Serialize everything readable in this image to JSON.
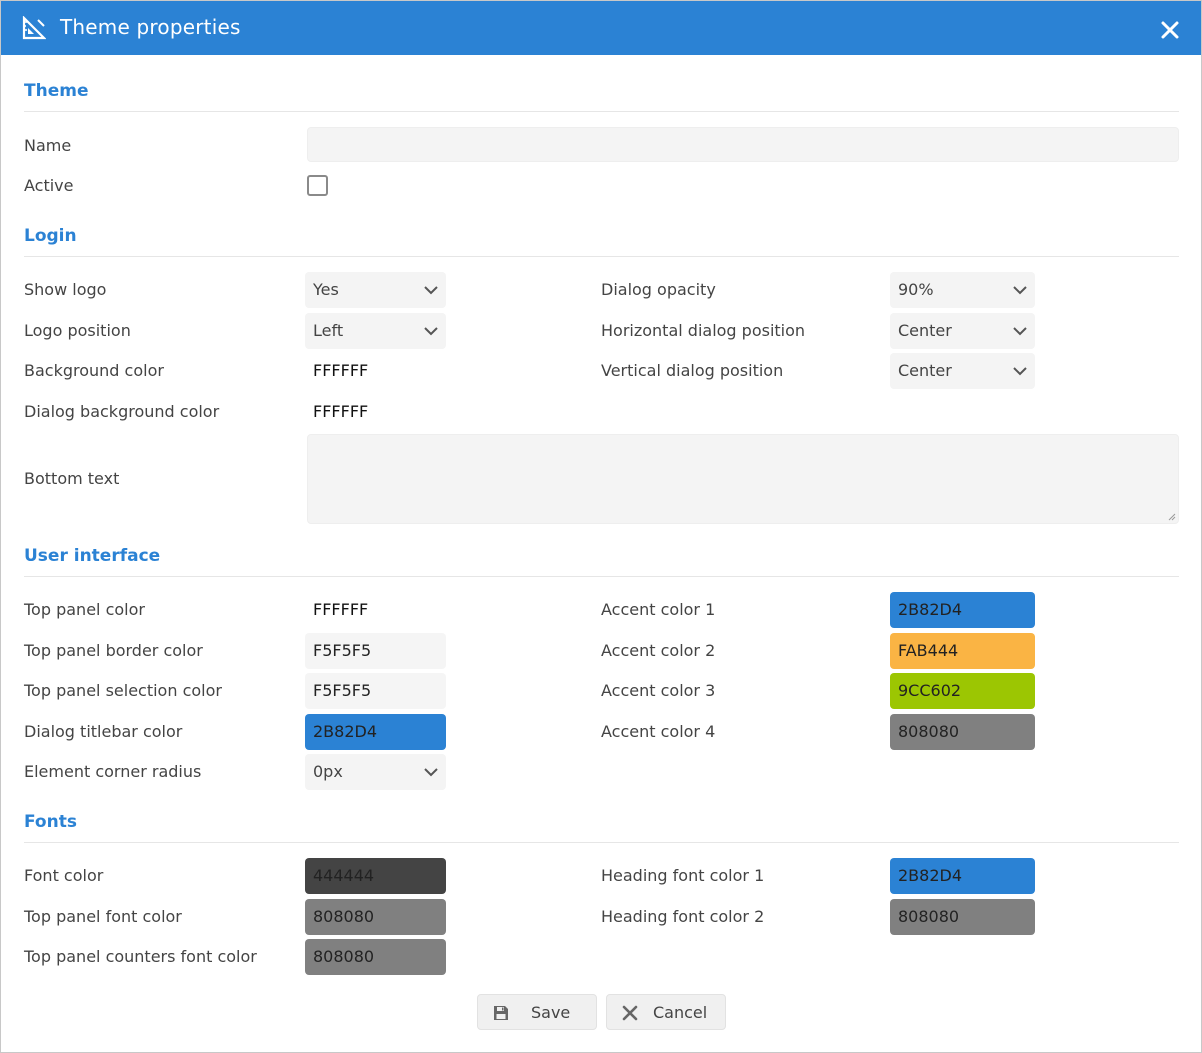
{
  "window": {
    "title": "Theme properties"
  },
  "sections": {
    "theme": "Theme",
    "login": "Login",
    "user_interface": "User interface",
    "fonts": "Fonts"
  },
  "theme": {
    "name_label": "Name",
    "name_value": "",
    "active_label": "Active",
    "active_checked": false
  },
  "login": {
    "show_logo_label": "Show logo",
    "show_logo_value": "Yes",
    "logo_position_label": "Logo position",
    "logo_position_value": "Left",
    "background_color_label": "Background color",
    "background_color_value": "FFFFFF",
    "dialog_background_color_label": "Dialog background color",
    "dialog_background_color_value": "FFFFFF",
    "bottom_text_label": "Bottom text",
    "bottom_text_value": "",
    "dialog_opacity_label": "Dialog opacity",
    "dialog_opacity_value": "90%",
    "horizontal_position_label": "Horizontal dialog position",
    "horizontal_position_value": "Center",
    "vertical_position_label": "Vertical dialog position",
    "vertical_position_value": "Center"
  },
  "ui": {
    "top_panel_color_label": "Top panel color",
    "top_panel_color_value": "FFFFFF",
    "top_panel_border_color_label": "Top panel border color",
    "top_panel_border_color_value": "F5F5F5",
    "top_panel_selection_color_label": "Top panel selection color",
    "top_panel_selection_color_value": "F5F5F5",
    "dialog_titlebar_color_label": "Dialog titlebar color",
    "dialog_titlebar_color_value": "2B82D4",
    "element_corner_radius_label": "Element corner radius",
    "element_corner_radius_value": "0px",
    "accent_color_1_label": "Accent color 1",
    "accent_color_1_value": "2B82D4",
    "accent_color_2_label": "Accent color 2",
    "accent_color_2_value": "FAB444",
    "accent_color_3_label": "Accent color 3",
    "accent_color_3_value": "9CC602",
    "accent_color_4_label": "Accent color 4",
    "accent_color_4_value": "808080"
  },
  "fonts": {
    "font_color_label": "Font color",
    "font_color_value": "444444",
    "top_panel_font_color_label": "Top panel font color",
    "top_panel_font_color_value": "808080",
    "top_panel_counters_font_color_label": "Top panel counters font color",
    "top_panel_counters_font_color_value": "808080",
    "heading_font_color_1_label": "Heading font color 1",
    "heading_font_color_1_value": "2B82D4",
    "heading_font_color_2_label": "Heading font color 2",
    "heading_font_color_2_value": "808080"
  },
  "buttons": {
    "save_label": "Save",
    "cancel_label": "Cancel"
  },
  "colors": {
    "titlebar": "#2B82D4",
    "accent_blue": "#2B82D4",
    "accent_orange": "#FAB444",
    "accent_green": "#9CC602",
    "gray": "#808080",
    "dark": "#444444",
    "light": "#F5F5F5"
  },
  "icons": {
    "title": "theme-ruler-icon",
    "close": "close-icon",
    "select": "chevron-down-icon",
    "save": "floppy-disk-icon",
    "cancel": "x-cancel-icon"
  }
}
